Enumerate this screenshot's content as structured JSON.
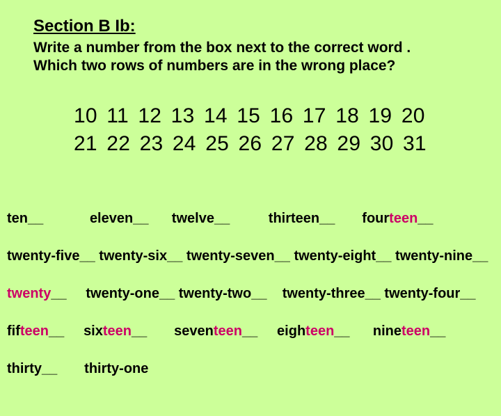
{
  "heading": {
    "title": "Section B  Ib:",
    "instruction_line1": "Write a number from the box next to the correct word .",
    "instruction_line2": "Which two rows of numbers are in the wrong place?"
  },
  "numbers": {
    "row1": "10 11 12 13 14 15 16 17 18 19 20",
    "row2": "21 22 23 24 25 26 27 28 29 30 31"
  },
  "words": {
    "r1": {
      "ten": "ten",
      "eleven": "eleven",
      "twelve": "twelve",
      "thirteen": "thirteen",
      "four": "four",
      "teen": "teen"
    },
    "r2": {
      "tfive": "twenty-five",
      "tsix": "twenty-six",
      "tseven": "twenty-seven",
      "teight": "twenty-eight",
      "tnine": "twenty-nine"
    },
    "r3": {
      "twenty": "twenty",
      "tone": "twenty-one",
      "ttwo": "twenty-two",
      "tthree": "twenty-three",
      "tfour": "twenty-four"
    },
    "r4": {
      "fif": "fif",
      "teen1": "teen",
      "six": "six",
      "teen2": "teen",
      "seven": "seven",
      "teen3": "teen",
      "eigh": "eigh",
      "teen4": "teen",
      "nine": "nine",
      "teen5": "teen"
    },
    "r5": {
      "thirty": "thirty",
      "thirtyone": "thirty-one"
    }
  },
  "blank": "__"
}
